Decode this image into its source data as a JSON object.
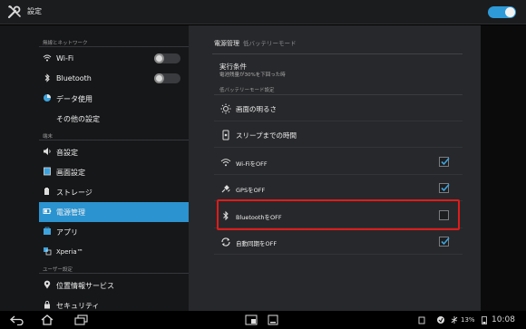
{
  "app": {
    "title": "設定",
    "icon": "wrench-screwdriver-icon",
    "master_toggle": "on"
  },
  "sidebar": {
    "sections": [
      {
        "header": "無線とネットワーク"
      },
      {
        "header": "端末"
      },
      {
        "header": "ユーザー設定"
      }
    ],
    "items": [
      {
        "label": "Wi-Fi",
        "icon": "wifi-icon",
        "toggle": "off"
      },
      {
        "label": "Bluetooth",
        "icon": "bluetooth-icon",
        "toggle": "off"
      },
      {
        "label": "データ使用",
        "icon": "data-usage-icon"
      },
      {
        "label": "その他の設定"
      },
      {
        "label": "音設定",
        "icon": "speaker-icon"
      },
      {
        "label": "画面設定",
        "icon": "display-icon"
      },
      {
        "label": "ストレージ",
        "icon": "storage-icon"
      },
      {
        "label": "電源管理",
        "icon": "battery-icon",
        "selected": true
      },
      {
        "label": "アプリ",
        "icon": "apps-icon"
      },
      {
        "label": "Xperia™",
        "icon": "xperia-icon"
      },
      {
        "label": "位置情報サービス",
        "icon": "location-icon"
      },
      {
        "label": "セキュリティ",
        "icon": "lock-icon"
      }
    ]
  },
  "detail": {
    "breadcrumb": "電源管理",
    "breadcrumb_sub": "低バッテリーモード",
    "condition": {
      "title": "実行条件",
      "subtitle": "電池残量が30%を下回った時"
    },
    "group_label": "低バッテリーモード設定",
    "settings": [
      {
        "label": "画面の明るさ",
        "icon": "brightness-icon"
      },
      {
        "label": "スリープまでの時間",
        "icon": "sleep-timer-icon"
      },
      {
        "label": "Wi-FiをOFF",
        "icon": "wifi-icon",
        "checked": true
      },
      {
        "label": "GPSをOFF",
        "icon": "gps-icon",
        "checked": true
      },
      {
        "label": "BluetoothをOFF",
        "icon": "bluetooth-icon",
        "checked": false,
        "highlighted": true
      },
      {
        "label": "自動同期をOFF",
        "icon": "sync-icon",
        "checked": true
      }
    ]
  },
  "navbar": {
    "buttons": [
      "back-icon",
      "home-icon",
      "recent-apps-icon",
      "small-app-icon",
      "screenshot-icon"
    ],
    "status": {
      "battery": "13%",
      "time": "10:08"
    }
  },
  "colors": {
    "accent": "#2b93cf",
    "highlight": "#e01b1b"
  }
}
